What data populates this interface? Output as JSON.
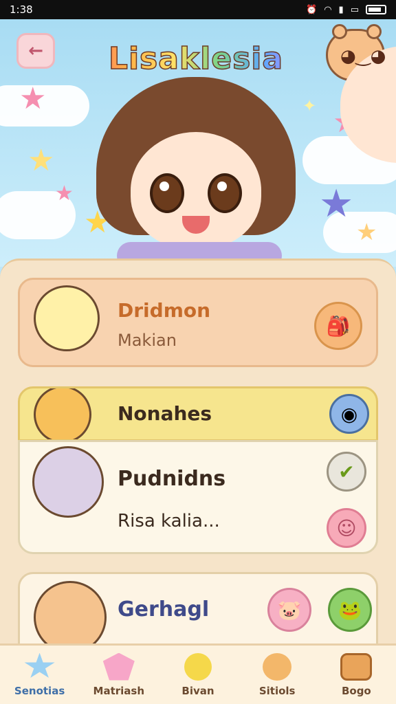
{
  "status_bar": {
    "time": "1:38"
  },
  "header": {
    "title": "Lisaklesia"
  },
  "cards": [
    {
      "title": "Dridmon",
      "subtitle": "Makian"
    },
    {
      "title": "Nonahes"
    },
    {
      "title": "Pudnidns",
      "subtitle": "Risa kalia..."
    },
    {
      "title": "Gerhagl"
    }
  ],
  "bottom_nav": [
    {
      "label": "Senotias",
      "icon": "star-icon"
    },
    {
      "label": "Matriash",
      "icon": "gem-icon"
    },
    {
      "label": "Bivan",
      "icon": "lemon-icon"
    },
    {
      "label": "Sitiols",
      "icon": "pet-icon"
    },
    {
      "label": "Bogo",
      "icon": "chest-icon"
    }
  ],
  "colors": {
    "sky": "#bfe6f7",
    "panel": "#f6e4c9",
    "accent": "#c0566d"
  }
}
